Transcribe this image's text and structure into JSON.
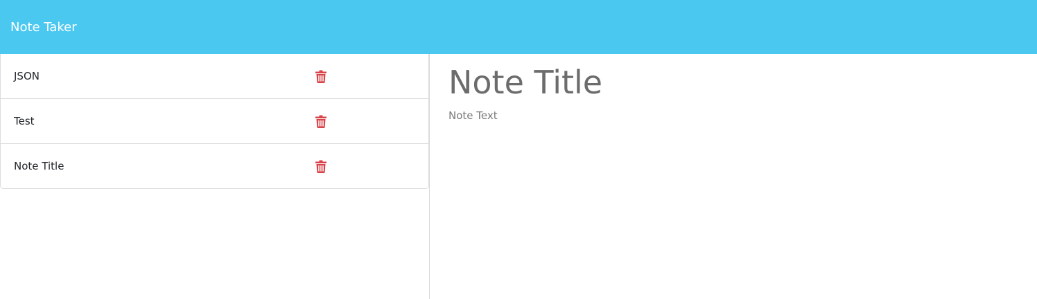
{
  "navbar": {
    "brand": "Note Taker",
    "background_color": "#4bc8f0"
  },
  "notes_list": [
    {
      "title": "JSON",
      "delete_icon": "trash-icon"
    },
    {
      "title": "Test",
      "delete_icon": "trash-icon"
    },
    {
      "title": "Note Title",
      "delete_icon": "trash-icon"
    }
  ],
  "editor": {
    "title_placeholder": "Note Title",
    "title_value": "",
    "text_placeholder": "Note Text",
    "text_value": ""
  },
  "colors": {
    "delete_icon": "#d9434a",
    "placeholder": "#6c6c6c"
  }
}
